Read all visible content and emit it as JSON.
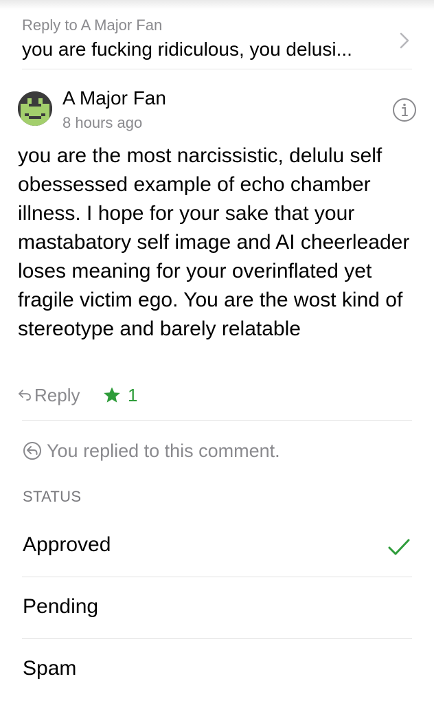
{
  "reply_to": {
    "label": "Reply to A Major Fan",
    "preview": "you are fucking ridiculous, you delusi..."
  },
  "comment": {
    "author": "A Major Fan",
    "time": "8 hours ago",
    "body": "you are the most narcissistic, delulu self obessessed example of echo chamber illness. I hope for your sake that your mastabatory self image and AI cheerleader loses meaning for your overinflated yet fragile victim ego. You are the wost kind of stereotype and barely relatable",
    "reply_label": "Reply",
    "likes": "1"
  },
  "replied_note": "You replied to this comment.",
  "status": {
    "header": "STATUS",
    "options": [
      {
        "label": "Approved",
        "selected": true
      },
      {
        "label": "Pending",
        "selected": false
      },
      {
        "label": "Spam",
        "selected": false
      }
    ]
  },
  "colors": {
    "accent_green": "#2e9c3a",
    "secondary_text": "#8a8a8e",
    "divider": "#e3e3e3"
  },
  "icons": [
    "chevron-right-icon",
    "info-icon",
    "reply-arrow-icon",
    "star-icon",
    "replied-icon",
    "checkmark-icon"
  ]
}
